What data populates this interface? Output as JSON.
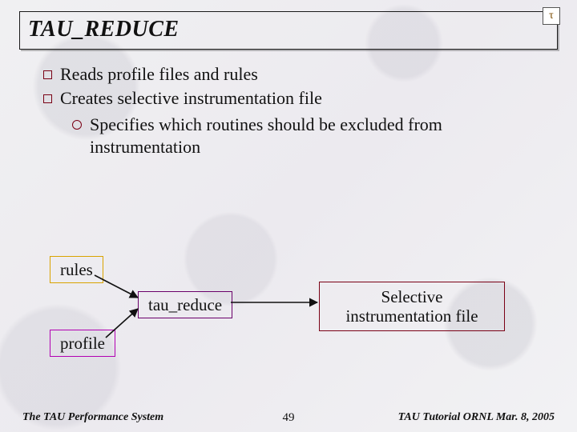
{
  "title": "TAU_REDUCE",
  "logo_glyph": "τ",
  "bullets": [
    "Reads profile files and rules",
    "Creates selective instrumentation file"
  ],
  "sub_bullet": "Specifies which routines should be excluded from instrumentation",
  "diagram": {
    "rules": "rules",
    "profile": "profile",
    "reduce": "tau_reduce",
    "selfile": "Selective instrumentation file"
  },
  "footer": {
    "left": "The TAU Performance System",
    "page": "49",
    "right": "TAU Tutorial ORNL Mar. 8, 2005"
  }
}
